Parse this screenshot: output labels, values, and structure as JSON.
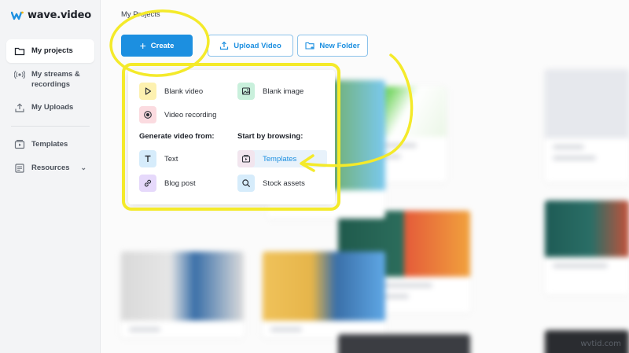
{
  "app": {
    "logo_text": "wave.video",
    "brand_color": "#1c8fe0",
    "highlight_color": "#f4ea2a"
  },
  "sidebar": {
    "items": [
      {
        "label": "My projects",
        "icon": "folder-icon",
        "active": true
      },
      {
        "label": "My streams & recordings",
        "icon": "broadcast-icon"
      },
      {
        "label": "My Uploads",
        "icon": "upload-icon"
      },
      {
        "label": "Templates",
        "icon": "template-icon"
      },
      {
        "label": "Resources",
        "icon": "document-icon",
        "has_chevron": true
      }
    ]
  },
  "header": {
    "breadcrumb": "My Projects",
    "create_label": "Create",
    "upload_label": "Upload Video",
    "folder_label": "New Folder"
  },
  "create_menu": {
    "items_top": [
      {
        "label": "Blank video",
        "icon": "play-icon"
      },
      {
        "label": "Blank image",
        "icon": "image-icon"
      },
      {
        "label": "Video recording",
        "icon": "record-icon"
      }
    ],
    "generate_heading": "Generate video from:",
    "browse_heading": "Start by browsing:",
    "generate_items": [
      {
        "label": "Text",
        "icon": "text-icon"
      },
      {
        "label": "Blog post",
        "icon": "link-icon"
      }
    ],
    "browse_items": [
      {
        "label": "Templates",
        "icon": "template-icon",
        "highlighted": true
      },
      {
        "label": "Stock assets",
        "icon": "search-icon"
      }
    ]
  },
  "watermark": "wvtid.com"
}
